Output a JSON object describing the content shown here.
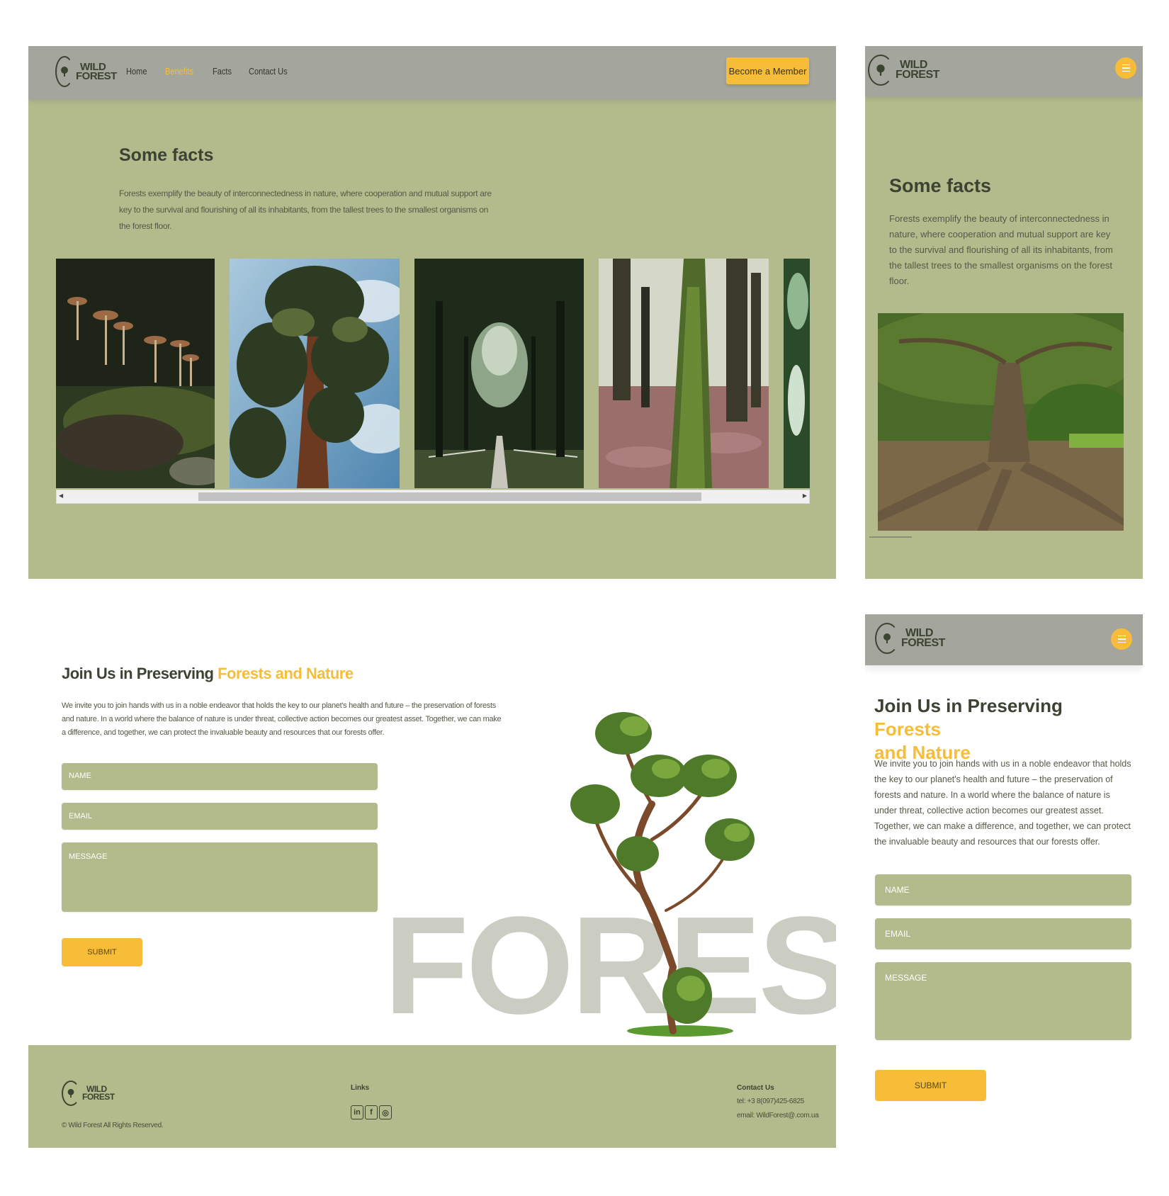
{
  "brand": {
    "line1": "WILD",
    "line2": "FOREST"
  },
  "nav": {
    "home": "Home",
    "benefits": "Benefits",
    "facts": "Facts",
    "contact": "Contact Us"
  },
  "header": {
    "cta": "Become a Member"
  },
  "facts": {
    "title": "Some facts",
    "text": "Forests exemplify the beauty of interconnectedness in nature, where cooperation and mutual support are key to the survival and flourishing of all its inhabitants, from the tallest trees to the smallest organisms on the forest floor.",
    "photos": [
      "mushrooms-photo",
      "tall-pine-photo",
      "oak-alley-photo",
      "mossy-trees-photo",
      "partial-photo"
    ]
  },
  "join": {
    "title_plain": "Join Us in Preserving",
    "title_highlight": "Forests and Nature",
    "title_highlight_1": "Forests",
    "title_highlight_2": "and Nature",
    "text": "We invite you to join hands with us in a noble endeavor that holds the key to our planet's health and future – the preservation of forests and nature. In a world where the balance of nature is under threat, collective action becomes our greatest asset. Together, we can make a difference, and together, we can protect the invaluable beauty and resources that our forests offer.",
    "name_placeholder": "NAME",
    "email_placeholder": "EMAIL",
    "message_placeholder": "MESSAGE",
    "submit": "SUBMIT",
    "big_word": "FOREST"
  },
  "footer": {
    "copyright": "© Wild Forest All Rights Reserved.",
    "links_title": "Links",
    "social": [
      "linkedin-icon",
      "facebook-icon",
      "instagram-icon"
    ],
    "contact_title": "Contact Us",
    "tel": "tel: +3 8(097)425-6825",
    "email": "email: WildForest@.com.ua"
  },
  "colors": {
    "olive": "#b3ba8c",
    "header_gray": "#a4a59c",
    "accent": "#f7bd38",
    "dark_text": "#3d4333"
  }
}
